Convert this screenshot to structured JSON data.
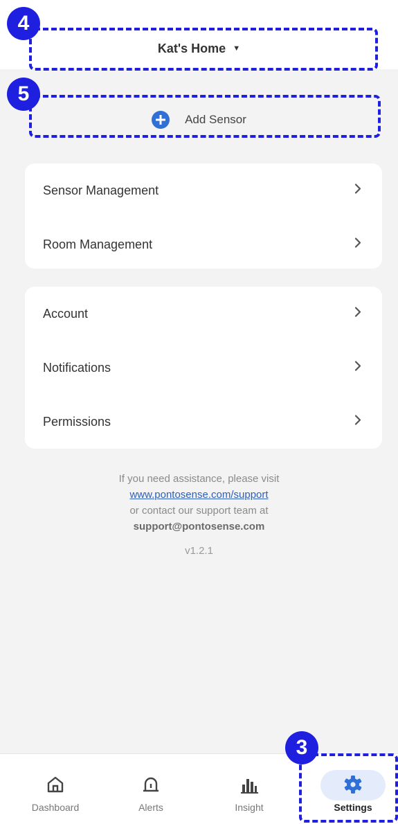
{
  "header": {
    "home_name": "Kat's Home",
    "caret_icon": "caret-down-icon"
  },
  "add_sensor": {
    "label": "Add Sensor",
    "icon": "plus-circle-icon"
  },
  "menu_groups": [
    {
      "items": [
        {
          "label": "Sensor Management"
        },
        {
          "label": "Room Management"
        }
      ]
    },
    {
      "items": [
        {
          "label": "Account"
        },
        {
          "label": "Notifications"
        },
        {
          "label": "Permissions"
        }
      ]
    }
  ],
  "help": {
    "line1": "If you need assistance, please visit",
    "link": "www.pontosense.com/support",
    "line3": "or contact our support team at",
    "email": "support@pontosense.com",
    "version": "v1.2.1"
  },
  "annotations": {
    "home": "4",
    "add": "5",
    "settings": "3"
  },
  "nav": {
    "items": [
      {
        "label": "Dashboard",
        "icon": "home-icon"
      },
      {
        "label": "Alerts",
        "icon": "alarm-icon"
      },
      {
        "label": "Insight",
        "icon": "bar-chart-icon"
      },
      {
        "label": "Settings",
        "icon": "gear-icon"
      }
    ],
    "active": "Settings",
    "accent": "#2f6fd6"
  }
}
